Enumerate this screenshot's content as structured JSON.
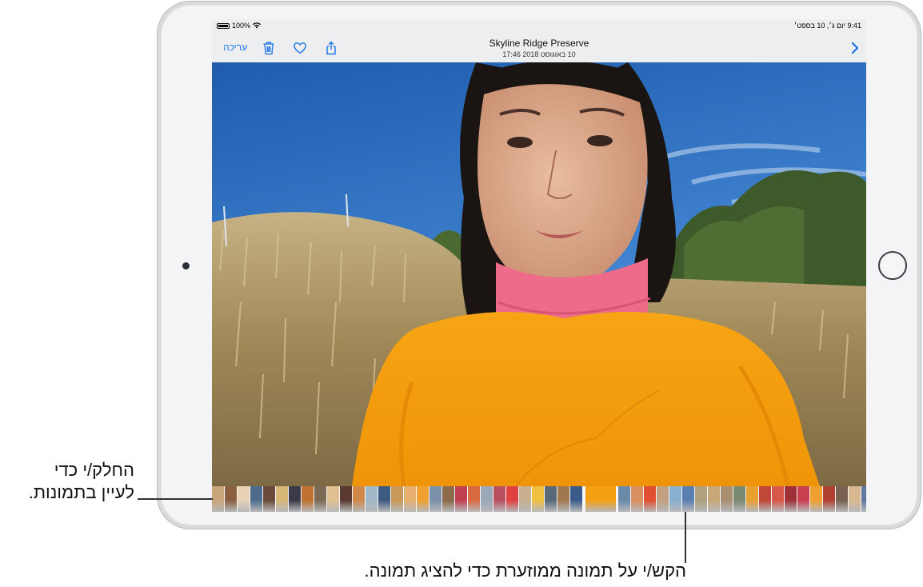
{
  "status_bar": {
    "battery": "100%",
    "datetime": "9:41  יום ג׳, 10 בספט׳"
  },
  "nav": {
    "edit_label": "עריכה",
    "title": "Skyline Ridge Preserve",
    "subtitle": "10 באוגוסט 2018 17:46",
    "icons": [
      "share-icon",
      "heart-icon",
      "trash-icon",
      "chevron-right-icon"
    ]
  },
  "callouts": {
    "swipe_line1": "החלק/י כדי",
    "swipe_line2": "לעיין בתמונות.",
    "tap_text": "הקש/י על תמונה ממוזערת כדי להציג תמונה."
  },
  "colors": {
    "accent": "#1a73e8",
    "sweater": "#f5a012",
    "sky": "#3576c4",
    "grass": "#b09a68"
  },
  "thumbnails": {
    "colors": [
      "#c9a57a",
      "#8a6040",
      "#e7d2b6",
      "#4e6b8c",
      "#6a4a3a",
      "#d8b878",
      "#3a3a48",
      "#c07030",
      "#7d6a55",
      "#e0c090",
      "#5a3a30",
      "#d08848",
      "#a0b8c8",
      "#3d5a80",
      "#c89858",
      "#e8b070",
      "#f0a030",
      "#7a90a8",
      "#8c6a4a",
      "#c04050",
      "#d86a40",
      "#9aa8b8",
      "#b85060",
      "#e04040",
      "#c8b090",
      "#f0c040",
      "#586878",
      "#a07850",
      "#3a5a8a",
      "#f5a012",
      "#6a8aa8",
      "#d89060",
      "#e05030",
      "#c0a080",
      "#8ab0d0",
      "#5a80b0",
      "#b0a080",
      "#c8a878",
      "#a89070",
      "#7a8a70",
      "#e8a030",
      "#c04838",
      "#d85848",
      "#a03038",
      "#c84050",
      "#f0a030",
      "#b04030",
      "#7a6050",
      "#d8b890",
      "#6078a0",
      "#c05040",
      "#e0c8a0",
      "#8aa0b8",
      "#c0a070"
    ],
    "selected_index": 29
  }
}
